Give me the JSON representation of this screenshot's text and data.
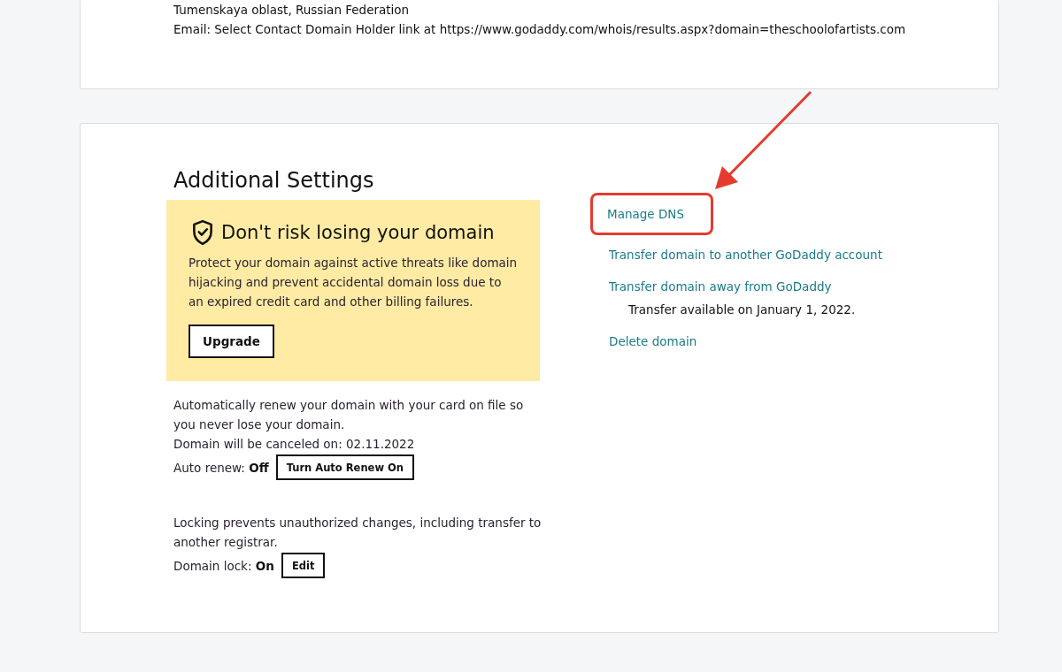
{
  "top_card": {
    "lines": [
      "Tumenskaya oblast, Russian Federation",
      "Email: Select Contact Domain Holder link at https://www.godaddy.com/whois/results.aspx?domain=theschoolofartists.com"
    ]
  },
  "additional_settings": {
    "title": "Additional Settings",
    "promo": {
      "heading": "Don't risk losing your domain",
      "text": "Protect your domain against active threats like domain hijacking and prevent accidental domain loss due to an expired credit card and other billing failures.",
      "button": "Upgrade"
    },
    "sections": [
      {
        "lines": [
          "Automatically renew your domain with your card on file so you never lose your domain.",
          "Domain will be canceled on: 02.11.2022"
        ],
        "label": "Auto renew:",
        "value": "Off",
        "button": "Turn Auto Renew On"
      },
      {
        "lines": [
          "Locking prevents unauthorized changes, including transfer to another registrar."
        ],
        "label": "Domain lock:",
        "value": "On",
        "button": "Edit"
      }
    ],
    "links": [
      {
        "label": "Manage DNS",
        "highlighted": true
      },
      {
        "label": "Transfer domain to another GoDaddy account",
        "highlighted": false
      },
      {
        "label": "Transfer domain away from GoDaddy",
        "highlighted": false,
        "note": "Transfer available on January 1, 2022."
      },
      {
        "label": "Delete domain",
        "highlighted": false
      }
    ]
  }
}
